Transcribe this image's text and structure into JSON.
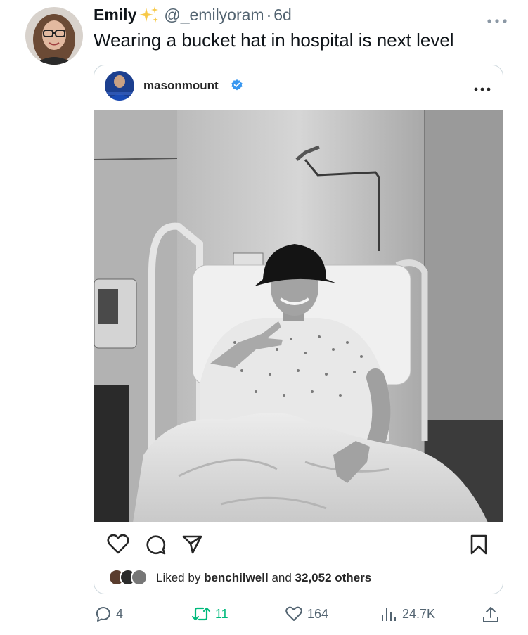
{
  "tweet": {
    "display_name": "Emily",
    "handle": "@_emilyoram",
    "separator": "·",
    "time": "6d",
    "text": "Wearing a bucket hat in hospital is next level"
  },
  "embed": {
    "username": "masonmount",
    "liked_prefix": "Liked by",
    "liked_user": "benchilwell",
    "liked_and": "and",
    "liked_others": "32,052 others"
  },
  "engagement": {
    "replies": "4",
    "retweets": "11",
    "likes": "164",
    "views": "24.7K"
  },
  "colors": {
    "text": "#0f1419",
    "secondary": "#536471",
    "retweet_green": "#00ba7c",
    "verified_blue": "#3897f0",
    "border": "#cfd9de"
  },
  "icons": [
    "sparkles-icon",
    "more-icon",
    "verified-icon",
    "heart-icon",
    "comment-icon",
    "share-icon",
    "bookmark-icon",
    "reply-icon",
    "retweet-icon",
    "like-icon",
    "views-icon",
    "upload-icon"
  ]
}
